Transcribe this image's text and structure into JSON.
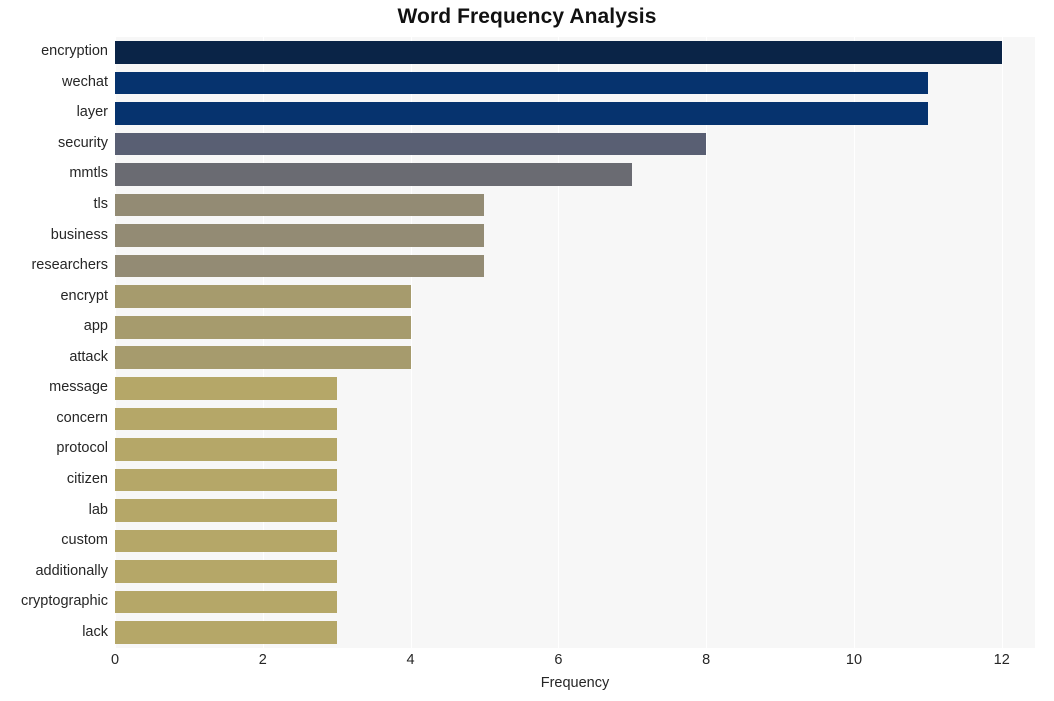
{
  "chart_data": {
    "type": "bar",
    "orientation": "horizontal",
    "title": "Word Frequency Analysis",
    "xlabel": "Frequency",
    "ylabel": "",
    "xlim": [
      0,
      12.45
    ],
    "xticks": [
      0,
      2,
      4,
      6,
      8,
      10,
      12
    ],
    "xtick_labels": [
      "0",
      "2",
      "4",
      "6",
      "8",
      "10",
      "12"
    ],
    "grid": "vertical-white-on-lightgray",
    "legend": "none",
    "categories": [
      "encryption",
      "wechat",
      "layer",
      "security",
      "mmtls",
      "tls",
      "business",
      "researchers",
      "encrypt",
      "app",
      "attack",
      "message",
      "concern",
      "protocol",
      "citizen",
      "lab",
      "custom",
      "additionally",
      "cryptographic",
      "lack"
    ],
    "values": [
      12,
      11,
      11,
      8,
      7,
      5,
      5,
      5,
      4,
      4,
      4,
      3,
      3,
      3,
      3,
      3,
      3,
      3,
      3,
      3
    ],
    "bar_colors": [
      "#0a2447",
      "#06336e",
      "#06336e",
      "#595f73",
      "#6a6b72",
      "#938b74",
      "#938b74",
      "#938b74",
      "#a69b6d",
      "#a69b6d",
      "#a69b6d",
      "#b5a768",
      "#b5a768",
      "#b5a768",
      "#b5a768",
      "#b5a768",
      "#b5a768",
      "#b5a768",
      "#b5a768",
      "#b5a768"
    ]
  },
  "style": {
    "plot_background": "#f7f7f7",
    "page_background": "#ffffff",
    "gridline_color": "#ffffff",
    "text_color": "#262626",
    "title_color": "#111111"
  }
}
